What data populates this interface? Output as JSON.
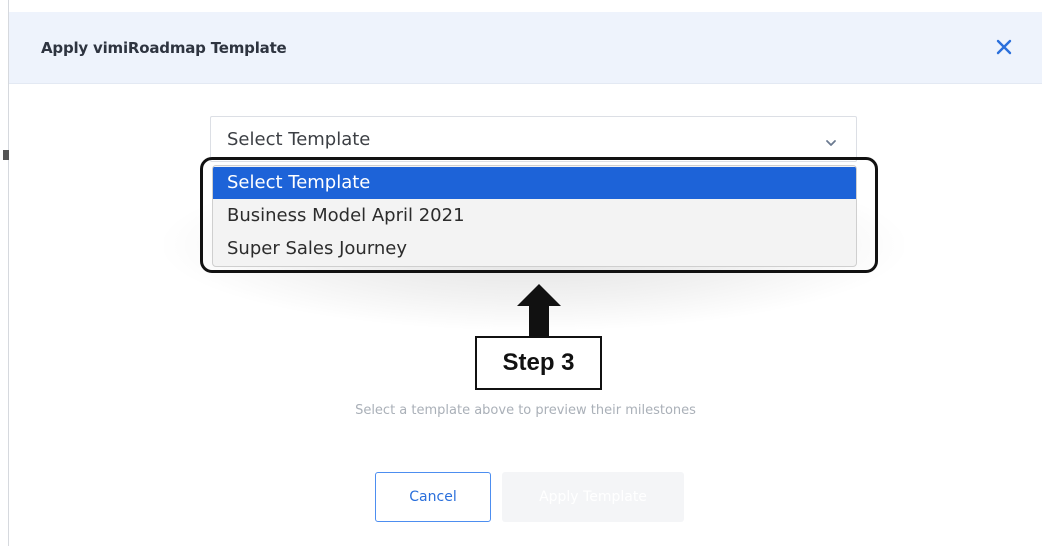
{
  "modal": {
    "title": "Apply vimiRoadmap Template",
    "close_icon": "close-icon"
  },
  "select": {
    "value": "Select Template",
    "icon": "chevron-down-icon",
    "options": [
      {
        "label": "Select Template",
        "selected": true
      },
      {
        "label": "Business Model April 2021",
        "selected": false
      },
      {
        "label": "Super Sales Journey",
        "selected": false
      }
    ]
  },
  "annotation": {
    "label": "Step 3",
    "icon": "arrow-up-icon"
  },
  "hint": "Select a template above to preview their milestones",
  "buttons": {
    "cancel": "Cancel",
    "apply": "Apply Template"
  },
  "colors": {
    "accent": "#1d63d8",
    "header_bg": "#eef3fc",
    "close": "#2a6fdb"
  }
}
